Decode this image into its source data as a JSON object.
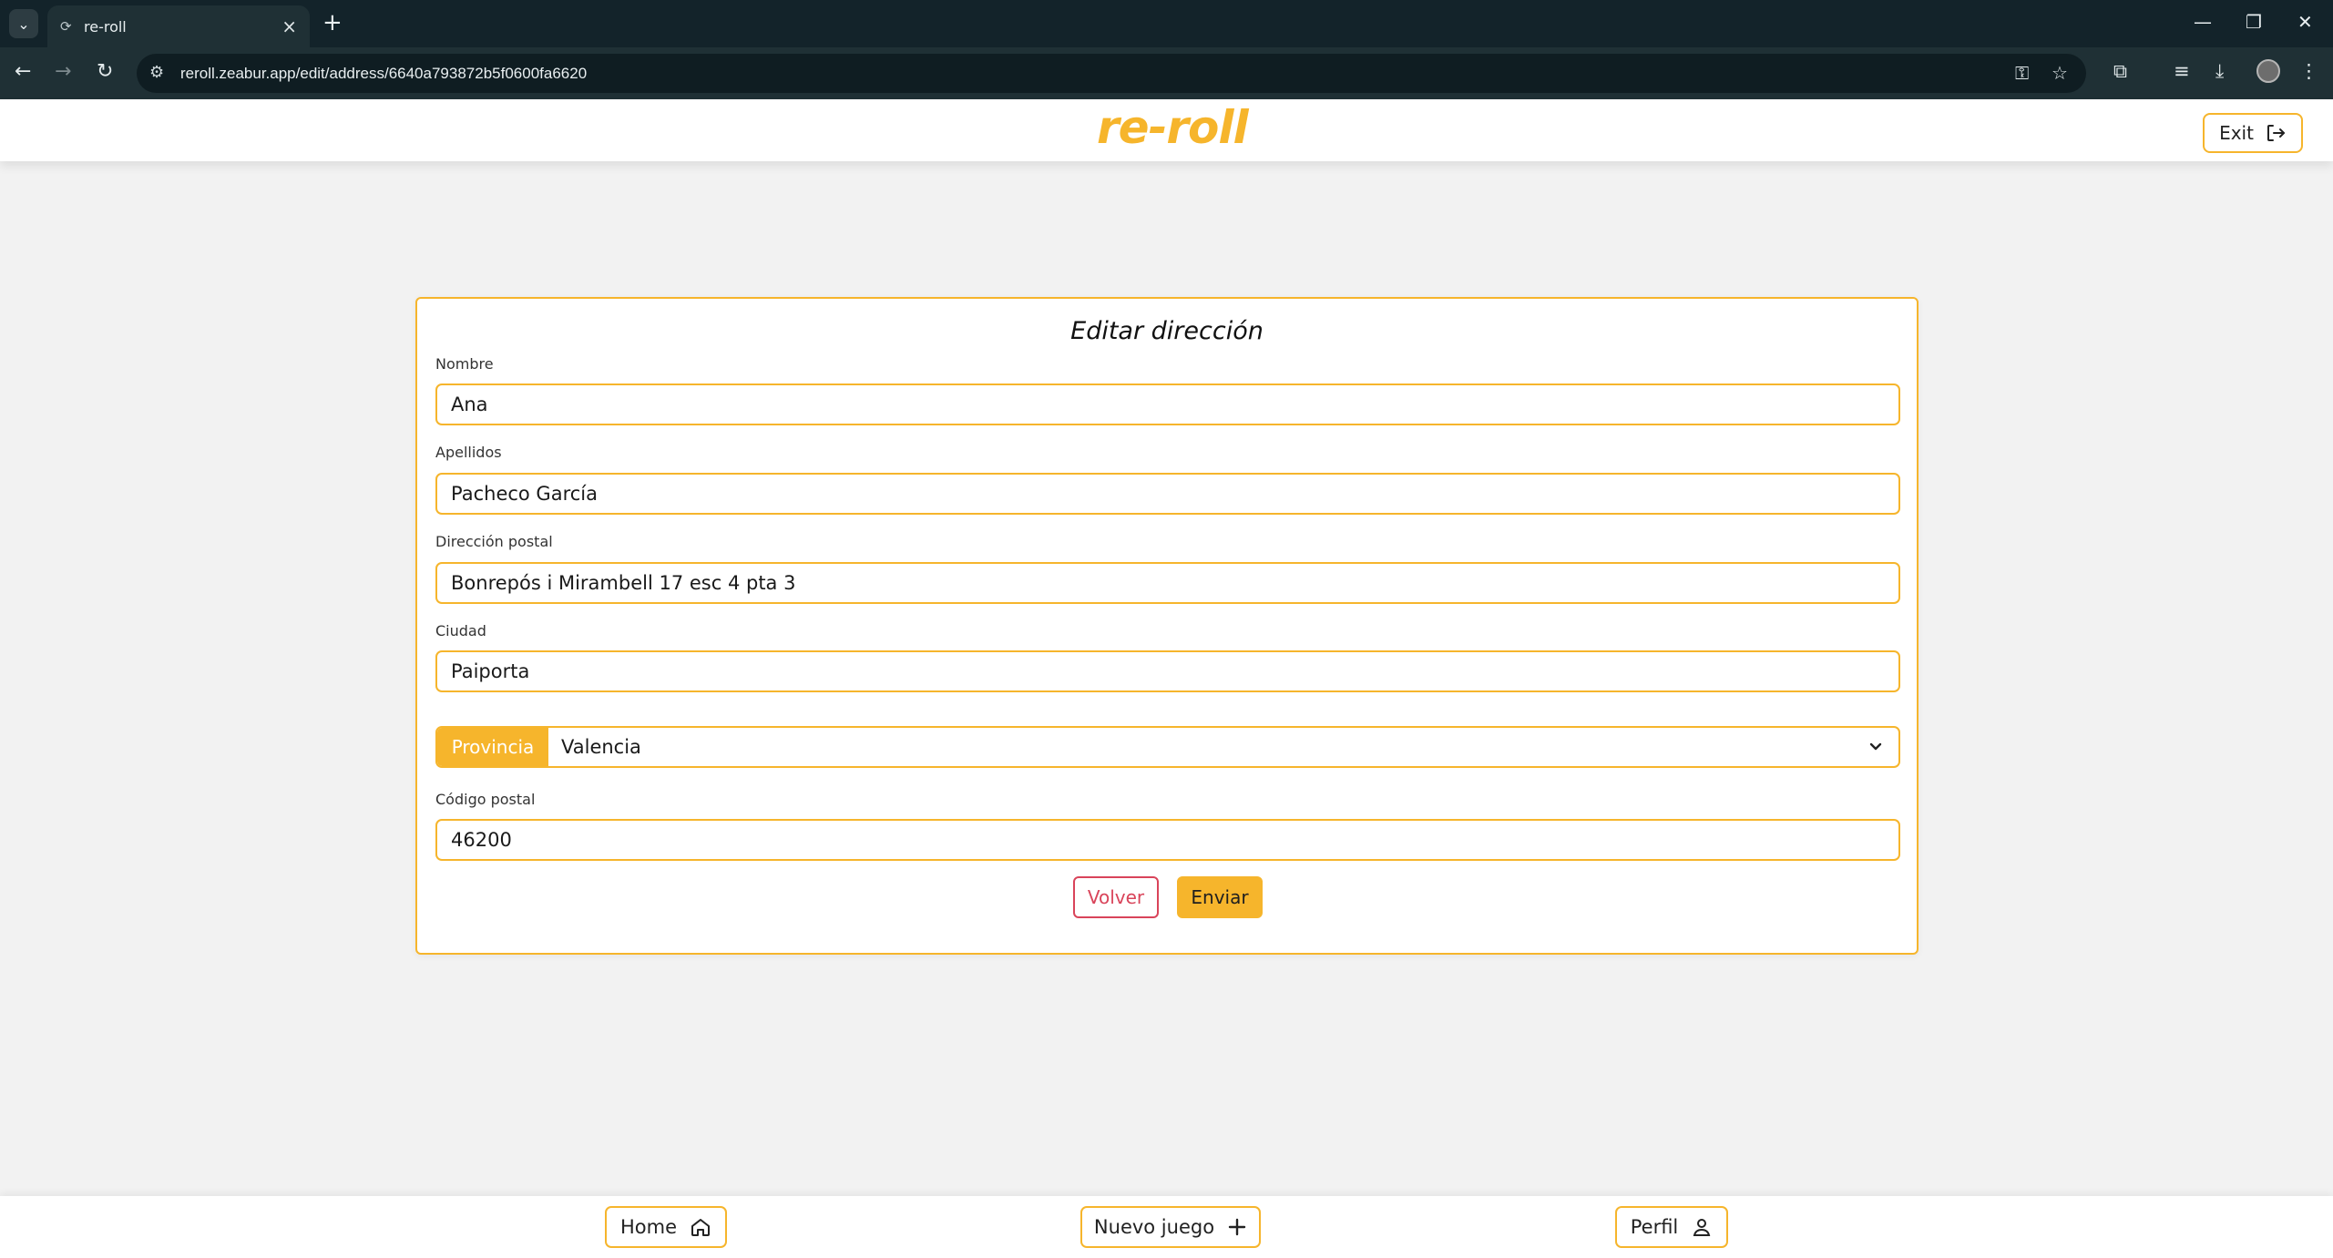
{
  "browser": {
    "tab_title": "re-roll",
    "url": "reroll.zeabur.app/edit/address/6640a793872b5f0600fa6620"
  },
  "header": {
    "logo": "re-roll",
    "exit_label": "Exit"
  },
  "form": {
    "title": "Editar dirección",
    "nombre": {
      "label": "Nombre",
      "value": "Ana"
    },
    "apellidos": {
      "label": "Apellidos",
      "value": "Pacheco García"
    },
    "direccion": {
      "label": "Dirección postal",
      "value": "Bonrepós i Mirambell 17 esc 4 pta 3"
    },
    "ciudad": {
      "label": "Ciudad",
      "value": "Paiporta"
    },
    "provincia": {
      "label": "Provincia",
      "value": "Valencia"
    },
    "codigo_postal": {
      "label": "Código postal",
      "value": "46200"
    },
    "volver_label": "Volver",
    "enviar_label": "Enviar"
  },
  "bottom_nav": {
    "home": "Home",
    "nuevo_juego": "Nuevo juego",
    "perfil": "Perfil"
  },
  "colors": {
    "accent": "#f6b52c",
    "danger": "#d9445a",
    "background": "#f2f2f2"
  }
}
